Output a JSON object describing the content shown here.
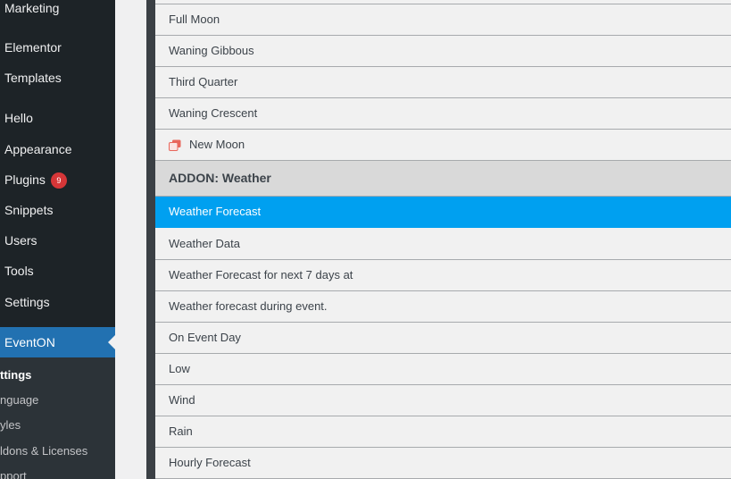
{
  "sidebar": {
    "items": [
      {
        "label": "Marketing"
      },
      {
        "label": "Elementor"
      },
      {
        "label": "Templates"
      },
      {
        "label": "Hello"
      },
      {
        "label": "Appearance"
      },
      {
        "label": "Plugins",
        "badge": "9"
      },
      {
        "label": "Snippets"
      },
      {
        "label": "Users"
      },
      {
        "label": "Tools"
      },
      {
        "label": "Settings"
      }
    ],
    "active": {
      "label": "EventON"
    },
    "submenu": [
      {
        "label": "ttings"
      },
      {
        "label": "nguage"
      },
      {
        "label": "yles"
      },
      {
        "label": "ldons & Licenses"
      },
      {
        "label": "pport"
      }
    ]
  },
  "list": {
    "rows": [
      {
        "label": "Full Moon"
      },
      {
        "label": "Waning Gibbous"
      },
      {
        "label": "Third Quarter"
      },
      {
        "label": "Waning Crescent"
      },
      {
        "label": "New Moon",
        "icon": "copy-icon"
      },
      {
        "label": "ADDON: Weather"
      },
      {
        "label": "Weather Forecast"
      },
      {
        "label": "Weather Data"
      },
      {
        "label": "Weather Forecast for next 7 days at"
      },
      {
        "label": "Weather forecast during event."
      },
      {
        "label": "On Event Day"
      },
      {
        "label": "Low"
      },
      {
        "label": "Wind"
      },
      {
        "label": "Rain"
      },
      {
        "label": "Hourly Forecast"
      }
    ]
  },
  "colors": {
    "sidebar_bg": "#1d2327",
    "active_menu": "#2271b1",
    "badge": "#d63638",
    "selected_row": "#00a0f0",
    "header_row": "#d9d9d9",
    "icon_accent": "#e8665b"
  }
}
